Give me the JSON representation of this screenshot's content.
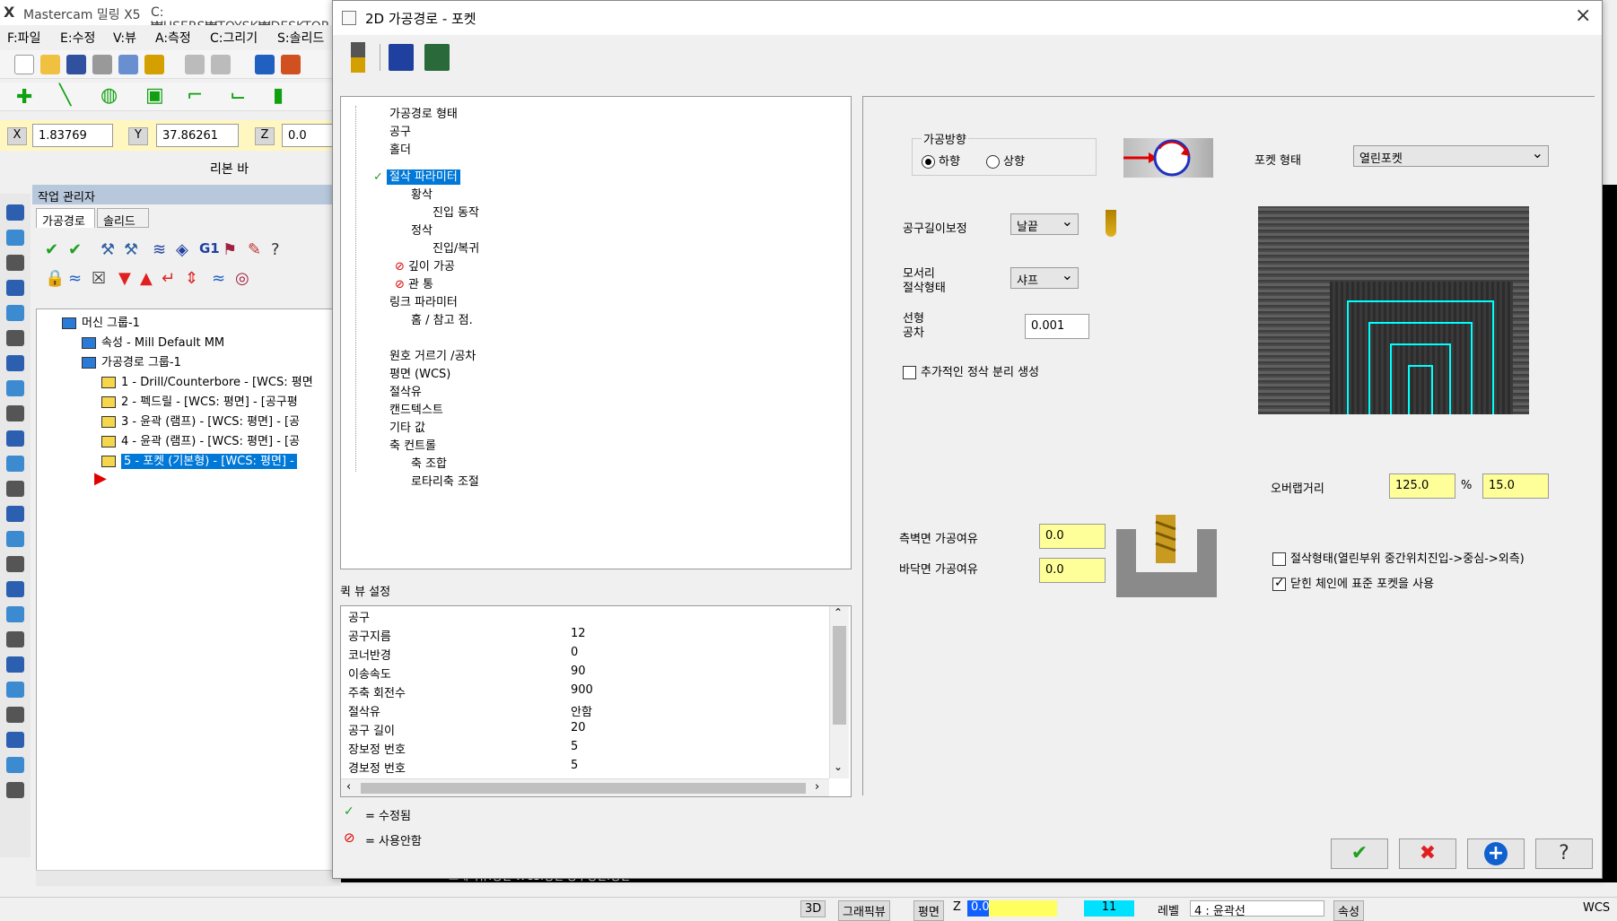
{
  "app": {
    "title": "Mastercam 밀링 X5",
    "path": "C:₩USERS₩TOYSK₩DESKTOP",
    "menu": [
      "F:파일",
      "E:수정",
      "V:뷰",
      "A:측정",
      "C:그리기",
      "S:솔리드"
    ],
    "coords": {
      "x_label": "X",
      "x": "1.83769",
      "y_label": "Y",
      "y": "37.86261",
      "z_label": "Z",
      "z": "0.0"
    },
    "ribbon_label": "리본 바",
    "ops_manager": {
      "title": "작업 관리자",
      "tabs": [
        "가공경로",
        "솔리드"
      ],
      "tree": [
        {
          "label": "머신 그룹-1",
          "level": 0
        },
        {
          "label": "속성 - Mill Default MM",
          "level": 1
        },
        {
          "label": "가공경로 그룹-1",
          "level": 1
        },
        {
          "label": "1 - Drill/Counterbore - [WCS: 평면",
          "level": 2
        },
        {
          "label": "2 - 펙드릴 - [WCS: 평면] - [공구평",
          "level": 2
        },
        {
          "label": "3 - 윤곽 (램프) - [WCS: 평면] - [공",
          "level": 2
        },
        {
          "label": "4 - 윤곽 (램프) - [WCS: 평면] - [공",
          "level": 2
        },
        {
          "label": "5 - 포켓 (기본형) - [WCS: 평면] -",
          "level": 2
        }
      ]
    },
    "status": {
      "view3d": "3D",
      "graphic_view": "그래픽뷰",
      "plane": "평면",
      "z_label": "Z",
      "z": "0.0",
      "level_num": "11",
      "level_label": "레벨",
      "level_value": "4 : 윤곽선",
      "attr": "속성",
      "wcs": "WCS"
    },
    "bg_text": "그래픽뷰:평면  WCS:평면  공구평면:평면"
  },
  "dialog": {
    "title": "2D 가공경로 - 포켓",
    "tree": [
      {
        "label": "가공경로 형태",
        "indent": 0,
        "mark": ""
      },
      {
        "label": "공구",
        "indent": 0,
        "mark": ""
      },
      {
        "label": "홀더",
        "indent": 0,
        "mark": ""
      },
      {
        "label": "절삭 파라미터",
        "indent": 0,
        "mark": "check",
        "selected": true
      },
      {
        "label": "황삭",
        "indent": 1,
        "mark": ""
      },
      {
        "label": "진입 동작",
        "indent": 2,
        "mark": ""
      },
      {
        "label": "정삭",
        "indent": 1,
        "mark": ""
      },
      {
        "label": "진입/복귀",
        "indent": 2,
        "mark": ""
      },
      {
        "label": "깊이 가공",
        "indent": 1,
        "mark": "disabled"
      },
      {
        "label": "관 통",
        "indent": 1,
        "mark": "disabled"
      },
      {
        "label": "링크 파라미터",
        "indent": 0,
        "mark": ""
      },
      {
        "label": "홈 / 참고 점.",
        "indent": 1,
        "mark": ""
      },
      {
        "label": "원호 거르기 /공차",
        "indent": 0,
        "mark": ""
      },
      {
        "label": "평면 (WCS)",
        "indent": 0,
        "mark": ""
      },
      {
        "label": "절삭유",
        "indent": 0,
        "mark": ""
      },
      {
        "label": "캔드텍스트",
        "indent": 0,
        "mark": ""
      },
      {
        "label": "기타 값",
        "indent": 0,
        "mark": ""
      },
      {
        "label": "축 컨트롤",
        "indent": 0,
        "mark": ""
      },
      {
        "label": "축 조합",
        "indent": 1,
        "mark": ""
      },
      {
        "label": "로타리축 조절",
        "indent": 1,
        "mark": ""
      }
    ],
    "quickview": {
      "title": "퀵 뷰 설정",
      "rows": [
        [
          "공구",
          ""
        ],
        [
          "공구지름",
          "12"
        ],
        [
          "코너반경",
          "0"
        ],
        [
          "이송속도",
          "90"
        ],
        [
          "주축 회전수",
          "900"
        ],
        [
          "절삭유",
          "안함"
        ],
        [
          "공구 길이",
          "20"
        ],
        [
          "장보정 번호",
          "5"
        ],
        [
          "경보정 번호",
          "5"
        ]
      ]
    },
    "legend": {
      "modified": "= 수정됨",
      "disabled": "= 사용안함"
    },
    "params": {
      "direction_title": "가공방향",
      "dir_down": "하향",
      "dir_up": "상향",
      "pocket_type_label": "포켓 형태",
      "pocket_type": "열린포켓",
      "comp_label": "공구길이보정",
      "comp_value": "날끝",
      "corner_label1": "모서리",
      "corner_label2": "절삭형태",
      "corner_value": "샤프",
      "linear_label1": "선형",
      "linear_label2": "공차",
      "linear_value": "0.001",
      "extra_finish": "추가적인 정삭 분리 생성",
      "overlap_label": "오버랩거리",
      "overlap_pct": "125.0",
      "overlap_pct_sym": "%",
      "overlap_dist": "15.0",
      "wall_stock_label": "측벽면 가공여유",
      "wall_stock": "0.0",
      "floor_stock_label": "바닥면 가공여유",
      "floor_stock": "0.0",
      "opt1": "절삭형태(열린부위 중간위치진입->중심->외측)",
      "opt2": "닫힌 체인에 표준 포켓을 사용"
    },
    "buttons": {
      "ok": "✔",
      "cancel": "✖",
      "add": "+",
      "help": "?"
    }
  },
  "colors": {
    "accent": "#0078d7",
    "yellow": "#ffff99",
    "cyan": "#00ffff",
    "red": "#e00000"
  }
}
